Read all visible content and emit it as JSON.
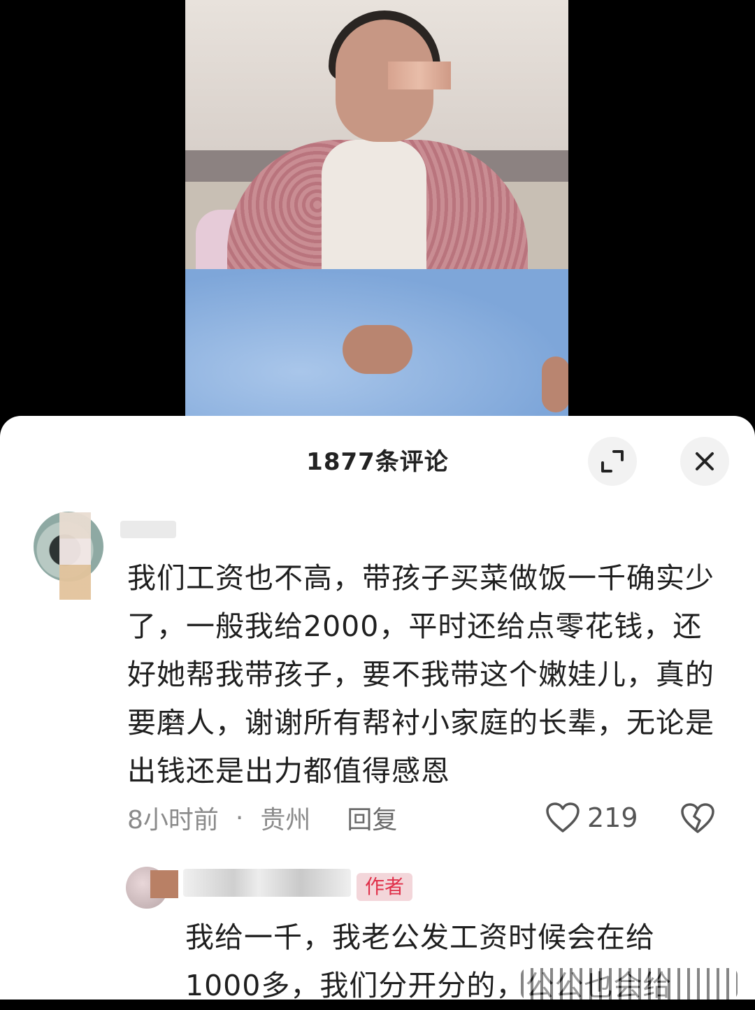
{
  "comments_panel": {
    "title": "1877条评论",
    "expand_icon": "expand-icon",
    "close_icon": "close-icon"
  },
  "comment": {
    "text": "我们工资也不高，带孩子买菜做饭一千确实少了，一般我给2000，平时还给点零花钱，还好她帮我带孩子，要不我带这个嫩娃儿，真的要磨人，谢谢所有帮衬小家庭的长辈，无论是出钱还是出力都值得感恩",
    "time": "8小时前",
    "dot": "·",
    "location": "贵州",
    "reply_label": "回复",
    "likes": "219",
    "like_icon": "heart-icon",
    "dislike_icon": "broken-heart-icon"
  },
  "reply": {
    "badge": "作者",
    "text": "我给一千，我老公发工资时候会在给1000多，我们分开分的，公公也会给"
  }
}
